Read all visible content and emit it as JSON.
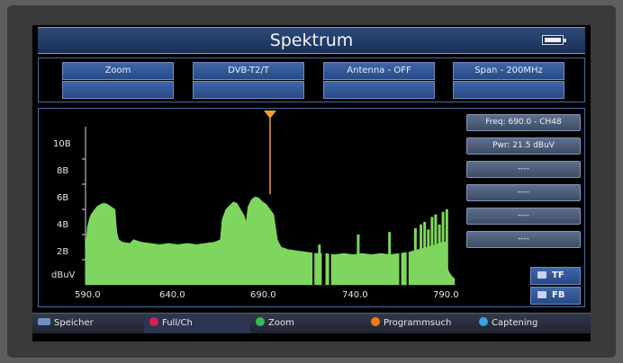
{
  "header": {
    "title": "Spektrum",
    "battery_icon": "battery-icon"
  },
  "buttons": [
    {
      "label": "Zoom",
      "sub": ""
    },
    {
      "label": "DVB-T2/T",
      "sub": ""
    },
    {
      "label": "Antenna - OFF",
      "sub": ""
    },
    {
      "label": "Span - 200MHz",
      "sub": ""
    }
  ],
  "info": {
    "freq": "Freq: 690.0 - CH48",
    "pwr": "Pwr: 21.5 dBuV",
    "slots": [
      "----",
      "----",
      "----",
      "----"
    ]
  },
  "side_buttons": [
    {
      "label": "TF",
      "icon": "tf-icon"
    },
    {
      "label": "FB",
      "icon": "fb-icon"
    }
  ],
  "footer": [
    {
      "label": "Speicher",
      "icon": "rect-icon",
      "color": "#6d8fc4"
    },
    {
      "label": "Full/Ch",
      "icon": "red-dot-icon",
      "color": "#d8204a"
    },
    {
      "label": "Zoom",
      "icon": "green-dot-icon",
      "color": "#2fbf4f"
    },
    {
      "label": "Programmsuch",
      "icon": "orange-dot-icon",
      "color": "#f07a1a"
    },
    {
      "label": "Captening",
      "icon": "blue-dot-icon",
      "color": "#3aa0e8"
    }
  ],
  "chart_data": {
    "type": "area",
    "ylabel": "dBuV",
    "y_ticks": [
      "2B",
      "4B",
      "6B",
      "8B",
      "10B"
    ],
    "x_ticks": [
      "590.0",
      "640.0",
      "690.0",
      "740.0",
      "790.0"
    ],
    "xlim": [
      590,
      790
    ],
    "ylim": [
      0,
      120
    ],
    "marker_freq": 690,
    "colors": {
      "fill": "#7fd65e",
      "marker": "#f0a030"
    },
    "points": [
      [
        590,
        28
      ],
      [
        591,
        46
      ],
      [
        592,
        52
      ],
      [
        593,
        56
      ],
      [
        594,
        58
      ],
      [
        596,
        62
      ],
      [
        598,
        64
      ],
      [
        600,
        65
      ],
      [
        602,
        64
      ],
      [
        604,
        62
      ],
      [
        606,
        60
      ],
      [
        607,
        42
      ],
      [
        608,
        36
      ],
      [
        610,
        34
      ],
      [
        614,
        33
      ],
      [
        616,
        36
      ],
      [
        620,
        34
      ],
      [
        625,
        33
      ],
      [
        630,
        32
      ],
      [
        635,
        33
      ],
      [
        640,
        32
      ],
      [
        645,
        33
      ],
      [
        650,
        32
      ],
      [
        655,
        33
      ],
      [
        660,
        34
      ],
      [
        663,
        36
      ],
      [
        664,
        52
      ],
      [
        666,
        60
      ],
      [
        668,
        63
      ],
      [
        670,
        66
      ],
      [
        672,
        65
      ],
      [
        674,
        60
      ],
      [
        676,
        55
      ],
      [
        677,
        50
      ],
      [
        678,
        62
      ],
      [
        680,
        68
      ],
      [
        682,
        70
      ],
      [
        684,
        69
      ],
      [
        686,
        66
      ],
      [
        688,
        64
      ],
      [
        690,
        60
      ],
      [
        692,
        56
      ],
      [
        693,
        46
      ],
      [
        694,
        36
      ],
      [
        696,
        30
      ],
      [
        700,
        28
      ],
      [
        705,
        27
      ],
      [
        710,
        26
      ],
      [
        715,
        25
      ],
      [
        720,
        25
      ],
      [
        725,
        24
      ],
      [
        730,
        25
      ],
      [
        735,
        24
      ],
      [
        740,
        25
      ],
      [
        745,
        24
      ],
      [
        750,
        25
      ],
      [
        755,
        24
      ],
      [
        760,
        25
      ],
      [
        765,
        26
      ],
      [
        770,
        28
      ],
      [
        775,
        30
      ],
      [
        780,
        32
      ],
      [
        783,
        34
      ],
      [
        785,
        34
      ],
      [
        786,
        14
      ],
      [
        787,
        10
      ],
      [
        788,
        8
      ],
      [
        789,
        6
      ],
      [
        790,
        5
      ]
    ],
    "spikes": [
      [
        716,
        32
      ],
      [
        737,
        40
      ],
      [
        754,
        42
      ],
      [
        768,
        45
      ],
      [
        771,
        48
      ],
      [
        773,
        50
      ],
      [
        775,
        44
      ],
      [
        777,
        54
      ],
      [
        779,
        56
      ],
      [
        781,
        48
      ],
      [
        783,
        58
      ],
      [
        785,
        60
      ]
    ],
    "gaps": [
      [
        713,
        714
      ],
      [
        718,
        720
      ],
      [
        722,
        723
      ],
      [
        760,
        761
      ],
      [
        764,
        765
      ]
    ]
  }
}
